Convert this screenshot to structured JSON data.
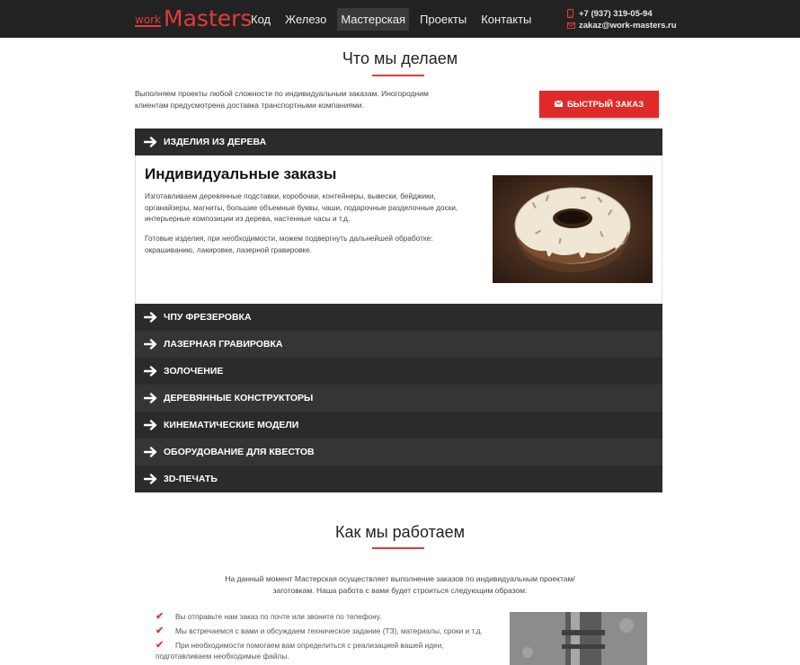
{
  "header": {
    "logo_work": "work",
    "logo_masters": "Masters",
    "nav": [
      "Код",
      "Железо",
      "Мастерская",
      "Проекты",
      "Контакты"
    ],
    "active_nav_index": 2,
    "phone": "+7 (937) 319-05-94",
    "email": "zakaz@work-masters.ru"
  },
  "section1": {
    "title": "Что мы делаем",
    "lead": "Выполняем проекты любой сложности по индивидуальным заказам. Иногородним клиентам предусмотрена доставка транспортными компаниями.",
    "quick_order_label": "БЫСТРЫЙ ЗАКАЗ",
    "accordion": {
      "open_item": "ИЗДЕЛИЯ ИЗ ДЕРЕВА",
      "open_body": {
        "heading": "Индивидуальные заказы",
        "p1": "Изготавливаем деревянные подставки, коробочки, контейнеры, вывески, бейджики, органайзеры, магниты, большие объемные буквы, чаши, подарочные разделочные доски, интерьерные композиции из дерева, настенные часы и т.д.",
        "p2": "Готовые изделия, при необходимости, можем подвергнуть дальнейшей обработке: окрашиванию, лакировке, лазерной гравировке."
      },
      "items": [
        "ЧПУ ФРЕЗЕРОВКА",
        "ЛАЗЕРНАЯ ГРАВИРОВКА",
        "ЗОЛОЧЕНИЕ",
        "ДЕРЕВЯННЫЕ КОНСТРУКТОРЫ",
        "КИНЕМАТИЧЕСКИЕ МОДЕЛИ",
        "ОБОРУДОВАНИЕ ДЛЯ КВЕСТОВ",
        "3D-ПЕЧАТЬ"
      ]
    }
  },
  "section2": {
    "title": "Как мы работаем",
    "lead": "На данный момент Мастерская осуществляет выполнение заказов по индивидуальным проектам/заготовкам. Наша работа с вами будет строиться следующим образом:",
    "steps": [
      "Вы отправьте нам заказ по почте или звоните по телефону.",
      "Мы встречаемся с вами и обсуждаем техническое задание (ТЗ), материалы, сроки и т.д.",
      "При необходимости помогаем вам определиться с реализацией вашей идеи,",
      "подготавливаем необходимые файлы."
    ]
  },
  "colors": {
    "accent": "#e23b3b",
    "dark": "#2b2b2b",
    "header": "#222222"
  }
}
